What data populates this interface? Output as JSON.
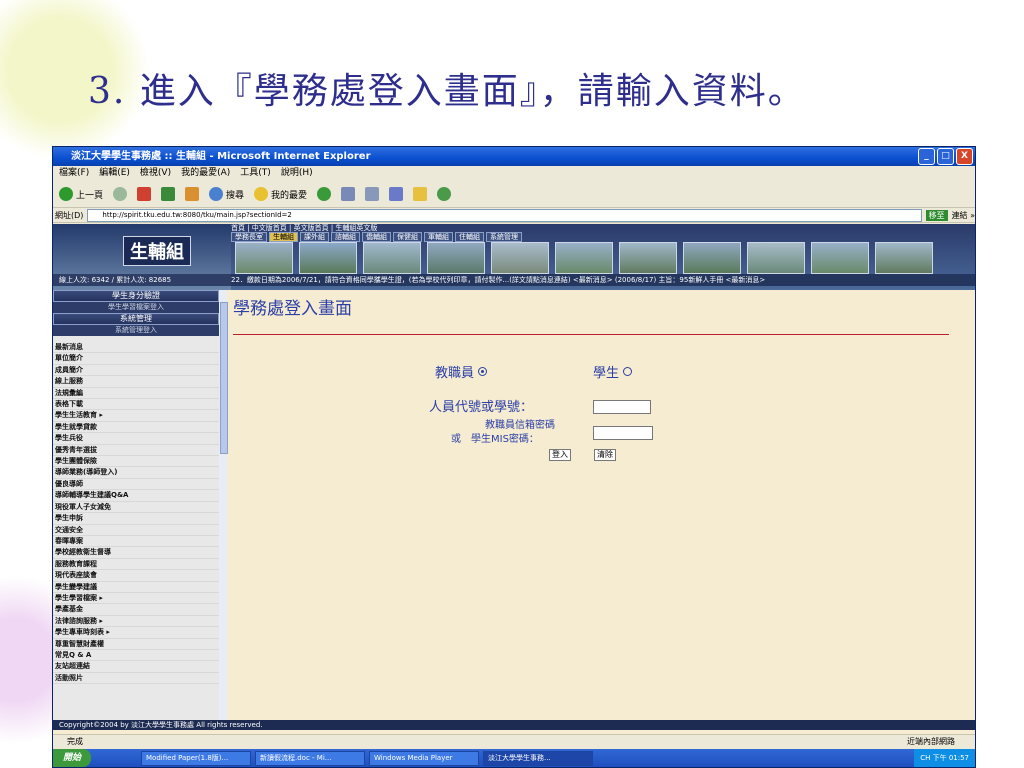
{
  "slide": {
    "title": "3. 進入『學務處登入畫面』，請輸入資料。"
  },
  "window": {
    "title": "淡江大學學生事務處 :: 生輔組 - Microsoft Internet Explorer",
    "minimize": "_",
    "maximize": "□",
    "close": "X"
  },
  "menubar": {
    "items": [
      "檔案(F)",
      "編輯(E)",
      "檢視(V)",
      "我的最愛(A)",
      "工具(T)",
      "說明(H)"
    ]
  },
  "toolbar": {
    "back": "上一頁",
    "search": "搜尋",
    "favorites": "我的最愛"
  },
  "addressbar": {
    "label": "網址(D)",
    "url": "http://spirit.tku.edu.tw:8080/tku/main.jsp?sectionId=2",
    "go": "移至",
    "links": "連結 »"
  },
  "banner": {
    "logo_text": "生輔組",
    "top_links": "首頁 | 中文版首頁 | 英文版首頁 | 生輔組英文版",
    "tabs": [
      "學務長室",
      "生輔組",
      "課外組",
      "諮輔組",
      "僑輔組",
      "保健組",
      "軍輔組",
      "住輔組",
      "系統管理"
    ],
    "counter": "線上人次: 6342 / 累計人次: 82685",
    "marquee": "22．繳款日期為2006/7/21，請符合資格同學攜學生證，(若為學校代列印章，請付製作...(詳文請點消息連結)  <最新消息> (2006/8/17) 主旨：95新鮮人手冊  <最新消息>"
  },
  "sidebar": {
    "section1": {
      "title": "學生身分驗證",
      "sub": "學生學習檔案登入"
    },
    "section2": {
      "title": "系統管理",
      "sub": "系統管理登入"
    },
    "items": [
      "最新消息",
      "單位簡介",
      "成員簡介",
      "線上服務",
      "法規彙編",
      "表格下載",
      "學生生活教育 ▸",
      "學生就學貸款",
      "學生兵役",
      "優秀青年選拔",
      "學生團體保險",
      "導師業務(導師登入)",
      "優良導師",
      "導師輔導學生建議Q&A",
      "現役軍人子女減免",
      "學生申訴",
      "交通安全",
      "春暉專案",
      "學校經教衛生督導",
      "服務教育課程",
      "現代表座談會",
      "學生變學建議",
      "學生學習檔案 ▸",
      "學產基金",
      "法律諮詢服務 ▸",
      "學生專車時刻表 ▸",
      "尊重智慧財產權",
      "常見Q & A",
      "友站超連結",
      "活動照片"
    ]
  },
  "main": {
    "heading": "學務處登入畫面",
    "role_staff": "教職員",
    "role_student": "學生",
    "id_label": "人員代號或學號：",
    "pw_label1": "教職員信箱密碼",
    "pw_label2": "或　學生MIS密碼：",
    "login": "登入",
    "clear": "清除"
  },
  "footer": {
    "copyright": "Copyright©2004 by 淡江大學學生事務處 All rights reserved."
  },
  "status": {
    "left": "完成",
    "right": "近端內部網路"
  },
  "taskbar": {
    "start": "開始",
    "tasks": [
      "Modified Paper(1.8版)...",
      "新讀假流程.doc - Mi...",
      "Windows Media Player",
      "淡江大學學生事務..."
    ],
    "clock": "CH 下午 01:57"
  },
  "colors": {
    "accent": "#2b3fa8",
    "rule": "#c0202a",
    "page_bg": "#f6ecd1",
    "title": "#2e2e8c"
  }
}
